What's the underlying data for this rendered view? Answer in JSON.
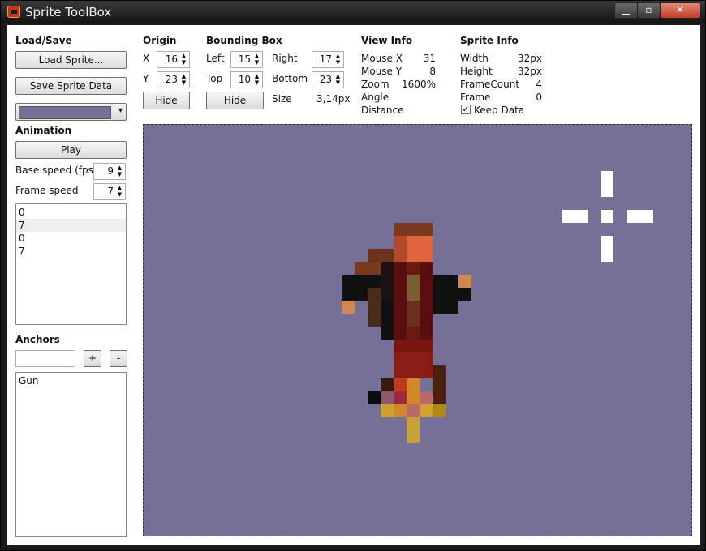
{
  "window": {
    "title": "Sprite ToolBox",
    "icon": "app-sprite-icon",
    "min": "▁",
    "max": "▫",
    "close": "✕"
  },
  "loadsave": {
    "header": "Load/Save",
    "load_label": "Load Sprite...",
    "save_label": "Save Sprite Data",
    "bg_color": "#767098",
    "dropdown_arrow": "▾"
  },
  "animation": {
    "header": "Animation",
    "play_label": "Play",
    "base_speed_label": "Base speed (fps)",
    "base_speed_value": "9",
    "frame_speed_label": "Frame speed",
    "frame_speed_value": "7",
    "frames": [
      "0",
      "7",
      "0",
      "7"
    ]
  },
  "anchors": {
    "header": "Anchors",
    "input_value": "",
    "add_label": "+",
    "remove_label": "-",
    "items": [
      "Gun"
    ]
  },
  "origin": {
    "header": "Origin",
    "x_label": "X",
    "x_value": "16",
    "y_label": "Y",
    "y_value": "23",
    "hide_label": "Hide"
  },
  "bbox": {
    "header": "Bounding Box",
    "left_label": "Left",
    "left_value": "15",
    "right_label": "Right",
    "right_value": "17",
    "top_label": "Top",
    "top_value": "10",
    "bottom_label": "Bottom",
    "bottom_value": "23",
    "hide_label": "Hide",
    "size_label": "Size",
    "size_value": "3,14px"
  },
  "view": {
    "header": "View Info",
    "mouse_x_label": "Mouse X",
    "mouse_x_value": "31",
    "mouse_y_label": "Mouse Y",
    "mouse_y_value": "8",
    "zoom_label": "Zoom",
    "zoom_value": "1600%",
    "angle_label": "Angle",
    "distance_label": "Distance"
  },
  "sprite": {
    "header": "Sprite Info",
    "width_label": "Width",
    "width_value": "32px",
    "height_label": "Height",
    "height_value": "32px",
    "framecount_label": "FrameCount",
    "framecount_value": "4",
    "frame_label": "Frame",
    "frame_value": "0",
    "keep_label": "Keep Data",
    "keep_checked": "✓"
  },
  "spinner": {
    "up": "▲",
    "down": "▼"
  },
  "canvas": {
    "bg_color": "#767098",
    "crosshair_color": "#ffffff"
  }
}
